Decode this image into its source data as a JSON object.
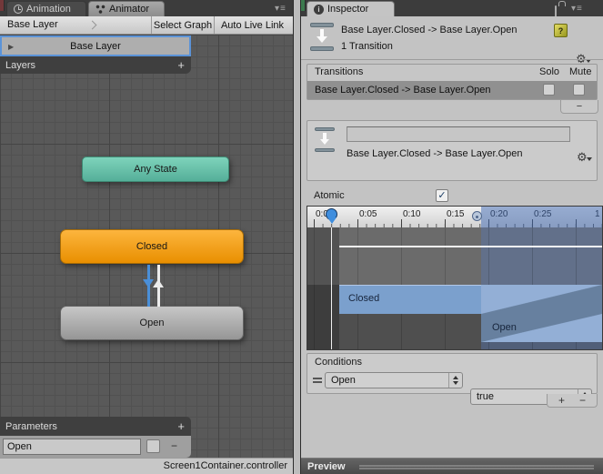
{
  "glyphs": {
    "menu": "▾≡",
    "info": "i",
    "help": "?",
    "gear": "⚙",
    "play": "▶",
    "check": "✓",
    "plus": "+",
    "minus": "−"
  },
  "colors": {
    "node_any_state": "#66C2A5",
    "node_closed": "#F5A623",
    "node_open": "#A8A8A8",
    "transition_selected_blue": "#4A8FD8",
    "selection_border_blue": "#5B93D8",
    "timeline_highlight_blue": "#7B9CD0",
    "clip_bar_blue": "#7BA0CD",
    "help_icon_yellow": "#C8C832"
  },
  "animator_panel": {
    "tabs": {
      "animation": "Animation",
      "animator": "Animator"
    },
    "breadcrumb": {
      "layer": "Base Layer"
    },
    "toolbar": {
      "select_graph": "Select Graph",
      "auto_live_link": "Auto Live Link"
    },
    "layers": {
      "selected": "Base Layer",
      "header": "Layers"
    },
    "graph": {
      "any_state": "Any State",
      "closed": "Closed",
      "open": "Open"
    },
    "parameters": {
      "header": "Parameters",
      "name": "Open"
    },
    "status": "Screen1Container.controller"
  },
  "inspector_panel": {
    "tab": "Inspector",
    "header": {
      "title": "Base Layer.Closed -> Base Layer.Open",
      "subtitle": "1 Transition"
    },
    "transitions": {
      "title": "Transitions",
      "solo": "Solo",
      "mute": "Mute",
      "row_label": "Base Layer.Closed -> Base Layer.Open"
    },
    "detail": {
      "name_value": "",
      "label": "Base Layer.Closed -> Base Layer.Open"
    },
    "atomic": {
      "label": "Atomic",
      "checked": true
    },
    "timeline": {
      "ticks": [
        "0:00",
        "0:05",
        "0:10",
        "0:15",
        "0:20",
        "0:25",
        "1"
      ],
      "clips": {
        "from": "Closed",
        "to": "Open"
      }
    },
    "conditions": {
      "title": "Conditions",
      "parameter": "Open",
      "value": "true"
    },
    "preview": {
      "label": "Preview"
    }
  }
}
